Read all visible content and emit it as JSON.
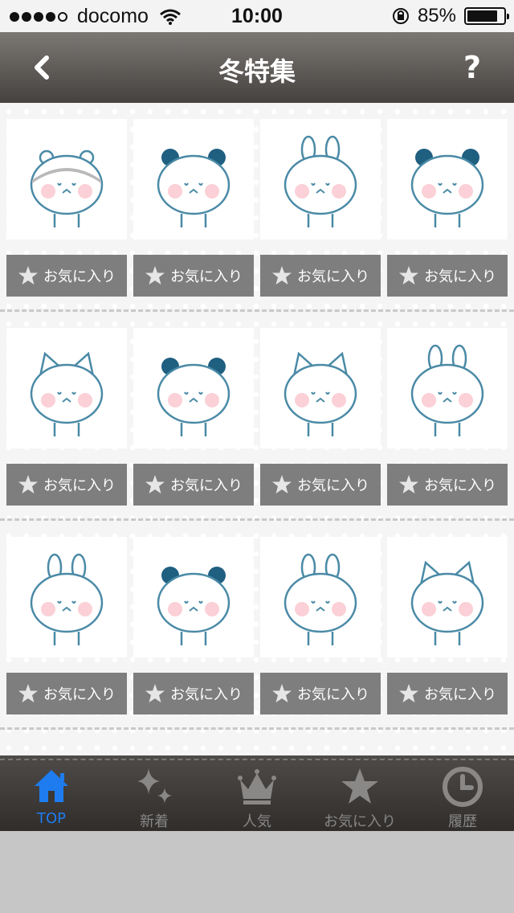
{
  "status": {
    "carrier": "docomo",
    "time": "10:00",
    "battery": "85%",
    "battery_level": 0.85
  },
  "nav": {
    "title": "冬特集",
    "back_icon": "chevron-left-icon",
    "help_label": "?"
  },
  "favorite_label": "お気に入り",
  "stickers": [
    {
      "character": "hamster"
    },
    {
      "character": "panda"
    },
    {
      "character": "rabbit"
    },
    {
      "character": "panda"
    },
    {
      "character": "cat"
    },
    {
      "character": "panda"
    },
    {
      "character": "cat"
    },
    {
      "character": "rabbit"
    },
    {
      "character": "rabbit"
    },
    {
      "character": "panda"
    },
    {
      "character": "rabbit"
    },
    {
      "character": "cat"
    }
  ],
  "tabs": [
    {
      "label": "TOP",
      "icon": "home-icon",
      "active": true
    },
    {
      "label": "新着",
      "icon": "sparkle-icon",
      "active": false
    },
    {
      "label": "人気",
      "icon": "crown-icon",
      "active": false
    },
    {
      "label": "お気に入り",
      "icon": "star-icon",
      "active": false
    },
    {
      "label": "履歴",
      "icon": "clock-icon",
      "active": false
    }
  ],
  "colors": {
    "accent": "#1e7cf0",
    "navbar": "#5f5b58",
    "fav_button": "#7e7e7e",
    "tab_inactive": "#888888"
  }
}
